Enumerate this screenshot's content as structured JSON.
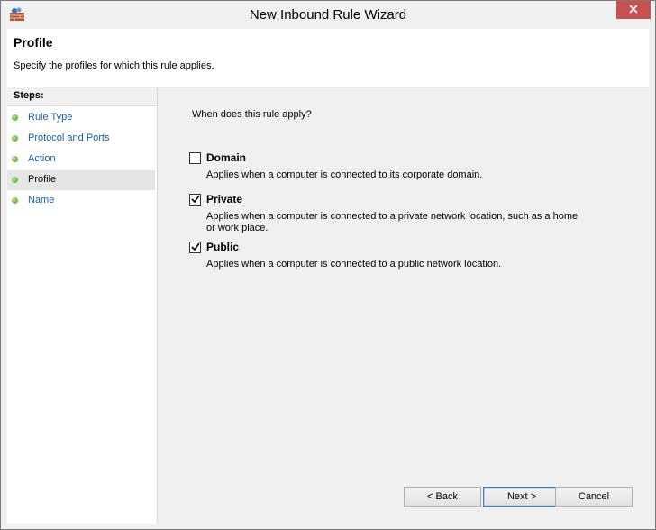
{
  "window": {
    "title": "New Inbound Rule Wizard",
    "close_icon": "close-icon",
    "app_icon": "firewall-icon",
    "close_color": "#c75050"
  },
  "header": {
    "title": "Profile",
    "description": "Specify the profiles for which this rule applies."
  },
  "steps": {
    "title": "Steps:",
    "items": [
      {
        "label": "Rule Type",
        "active": false
      },
      {
        "label": "Protocol and Ports",
        "active": false
      },
      {
        "label": "Action",
        "active": false
      },
      {
        "label": "Profile",
        "active": true
      },
      {
        "label": "Name",
        "active": false
      }
    ]
  },
  "content": {
    "question": "When does this rule apply?",
    "options": [
      {
        "label": "Domain",
        "checked": false,
        "description": "Applies when a computer is connected to its corporate domain."
      },
      {
        "label": "Private",
        "checked": true,
        "description": "Applies when a computer is connected to a private network location, such as a home or work place."
      },
      {
        "label": "Public",
        "checked": true,
        "description": "Applies when a computer is connected to a public network location."
      }
    ]
  },
  "buttons": {
    "back": "< Back",
    "next": "Next >",
    "cancel": "Cancel"
  }
}
